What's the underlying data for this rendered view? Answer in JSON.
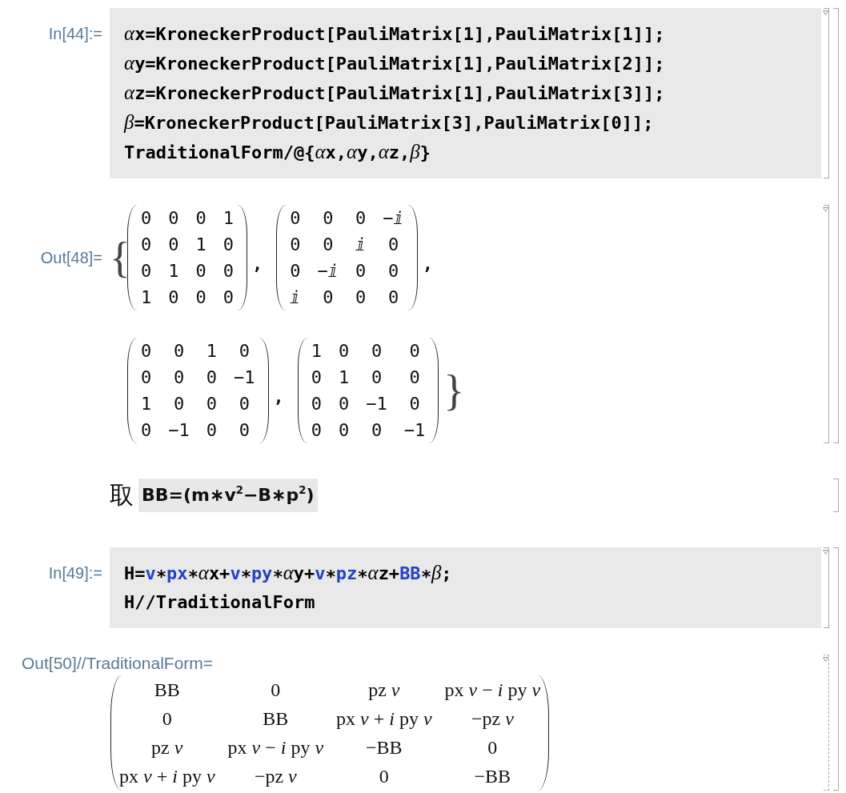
{
  "groups": [
    {
      "cells": [
        {
          "kind": "input",
          "label": "In[44]:=",
          "lines": [
            [
              {
                "text": "α",
                "kind": "greek"
              },
              {
                "text": "x=KroneckerProduct[PauliMatrix[1],PauliMatrix[1]];",
                "kind": "plain"
              }
            ],
            [
              {
                "text": "α",
                "kind": "greek"
              },
              {
                "text": "y=KroneckerProduct[PauliMatrix[1],PauliMatrix[2]];",
                "kind": "plain"
              }
            ],
            [
              {
                "text": "α",
                "kind": "greek"
              },
              {
                "text": "z=KroneckerProduct[PauliMatrix[1],PauliMatrix[3]];",
                "kind": "plain"
              }
            ],
            [
              {
                "text": "β",
                "kind": "greek"
              },
              {
                "text": "=KroneckerProduct[PauliMatrix[3],PauliMatrix[0]];",
                "kind": "plain"
              }
            ],
            [
              {
                "text": "TraditionalForm/@{",
                "kind": "plain"
              },
              {
                "text": "α",
                "kind": "greek"
              },
              {
                "text": "x,",
                "kind": "plain"
              },
              {
                "text": "α",
                "kind": "greek"
              },
              {
                "text": "y,",
                "kind": "plain"
              },
              {
                "text": "α",
                "kind": "greek"
              },
              {
                "text": "z,",
                "kind": "plain"
              },
              {
                "text": "β",
                "kind": "greek"
              },
              {
                "text": "}",
                "kind": "plain"
              }
            ]
          ]
        },
        {
          "kind": "matrix_list",
          "label": "Out[48]=",
          "open": "{",
          "close": "}",
          "matrices": [
            {
              "rows": [
                [
                  "0",
                  "0",
                  "0",
                  "1"
                ],
                [
                  "0",
                  "0",
                  "1",
                  "0"
                ],
                [
                  "0",
                  "1",
                  "0",
                  "0"
                ],
                [
                  "1",
                  "0",
                  "0",
                  "0"
                ]
              ],
              "separator": ","
            },
            {
              "rows": [
                [
                  "0",
                  "0",
                  "0",
                  "−ⅈ"
                ],
                [
                  "0",
                  "0",
                  "ⅈ",
                  "0"
                ],
                [
                  "0",
                  "−ⅈ",
                  "0",
                  "0"
                ],
                [
                  "ⅈ",
                  "0",
                  "0",
                  "0"
                ]
              ],
              "separator": ","
            },
            {
              "rows": [
                [
                  "0",
                  "0",
                  "1",
                  "0"
                ],
                [
                  "0",
                  "0",
                  "0",
                  "−1"
                ],
                [
                  "1",
                  "0",
                  "0",
                  "0"
                ],
                [
                  "0",
                  "−1",
                  "0",
                  "0"
                ]
              ],
              "separator": ","
            },
            {
              "rows": [
                [
                  "1",
                  "0",
                  "0",
                  "0"
                ],
                [
                  "0",
                  "1",
                  "0",
                  "0"
                ],
                [
                  "0",
                  "0",
                  "−1",
                  "0"
                ],
                [
                  "0",
                  "0",
                  "0",
                  "−1"
                ]
              ]
            }
          ]
        }
      ]
    },
    {
      "cells": [
        {
          "kind": "text",
          "text": "取",
          "formula": "BB=(m∗v$^{2}$−B∗p$^{2}$)"
        }
      ]
    },
    {
      "cells": [
        {
          "kind": "input",
          "label": "In[49]:=",
          "lines": [
            [
              {
                "text": "H=",
                "kind": "plain"
              },
              {
                "text": "v",
                "kind": "undefined"
              },
              {
                "text": "∗",
                "kind": "plain"
              },
              {
                "text": "px",
                "kind": "undefined"
              },
              {
                "text": "∗",
                "kind": "plain"
              },
              {
                "text": "α",
                "kind": "greek"
              },
              {
                "text": "x+",
                "kind": "plain"
              },
              {
                "text": "v",
                "kind": "undefined"
              },
              {
                "text": "∗",
                "kind": "plain"
              },
              {
                "text": "py",
                "kind": "undefined"
              },
              {
                "text": "∗",
                "kind": "plain"
              },
              {
                "text": "α",
                "kind": "greek"
              },
              {
                "text": "y+",
                "kind": "plain"
              },
              {
                "text": "v",
                "kind": "undefined"
              },
              {
                "text": "∗",
                "kind": "plain"
              },
              {
                "text": "pz",
                "kind": "undefined"
              },
              {
                "text": "∗",
                "kind": "plain"
              },
              {
                "text": "α",
                "kind": "greek"
              },
              {
                "text": "z+",
                "kind": "plain"
              },
              {
                "text": "BB",
                "kind": "undefined"
              },
              {
                "text": "∗",
                "kind": "plain"
              },
              {
                "text": "β",
                "kind": "greek"
              },
              {
                "text": ";",
                "kind": "plain"
              }
            ],
            [
              {
                "text": "H//TraditionalForm",
                "kind": "plain"
              }
            ]
          ]
        },
        {
          "kind": "traditional_output",
          "label": "Out[50]//TraditionalForm=",
          "matrix": [
            [
              "BB",
              "0",
              "pz *v*",
              "px *v* − *i* py *v*"
            ],
            [
              "0",
              "BB",
              "px *v* + *i* py *v*",
              "−pz *v*"
            ],
            [
              "pz *v*",
              "px *v* − *i* py *v*",
              "−BB",
              "0"
            ],
            [
              "px *v* + *i* py *v*",
              "−pz *v*",
              "0",
              "−BB"
            ]
          ]
        }
      ]
    }
  ]
}
